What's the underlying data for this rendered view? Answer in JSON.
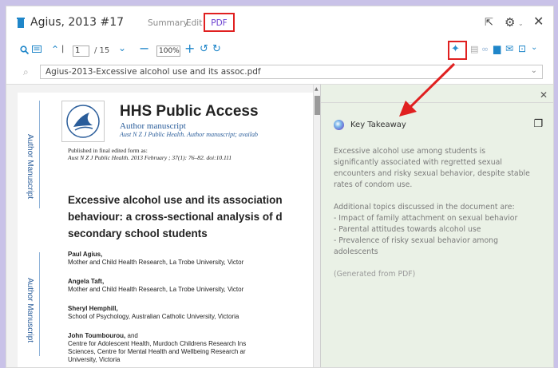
{
  "window": {
    "title": "Agius, 2013 #17",
    "tabs": [
      "Summary",
      "Edit",
      "PDF"
    ],
    "icons_right": [
      "external-link-icon",
      "gear-icon",
      "close-icon"
    ]
  },
  "toolbar": {
    "page_current": "1",
    "page_total": "/ 15",
    "zoom": "100%"
  },
  "file": {
    "name": "Agius-2013-Excessive alcohol use and its assoc.pdf"
  },
  "pdf": {
    "header": "HHS Public Access",
    "author_manuscript": "Author manuscript",
    "journal_line": "Aust N Z J Public Health. Author manuscript; availab",
    "published_in": "Published in final edited form as:",
    "citation": "Aust N Z J Public Health. 2013 February ; 37(1): 76–82. doi:10.111",
    "side_label": "Author Manuscript",
    "title_lines": [
      "Excessive alcohol use and its association",
      "behaviour: a cross-sectional analysis of d",
      "secondary school students"
    ],
    "authors": [
      {
        "name": "Paul Agius,",
        "affil": "Mother and Child Health Research, La Trobe University, Victor"
      },
      {
        "name": "Angela Taft,",
        "affil": "Mother and Child Health Research, La Trobe University, Victor"
      },
      {
        "name": "Sheryl Hemphill,",
        "affil": "School of Psychology, Australian Catholic University, Victoria"
      },
      {
        "name": "John Toumbourou,",
        "suffix": "and",
        "affil": "Centre for Adolescent Health, Murdoch Childrens Research Ins"
      }
    ],
    "extra_lines": [
      "Sciences, Centre for Mental Health and Wellbeing Research ar",
      "University, Victoria"
    ]
  },
  "ai_panel": {
    "heading": "Key Takeaway",
    "paragraph1": [
      "Excessive alcohol use among students is",
      "significantly associated with regretted sexual",
      "encounters and risky sexual behavior, despite stable",
      "rates of condom use."
    ],
    "paragraph2": [
      "Additional topics discussed in the document are:",
      "- Impact of family attachment on sexual behavior",
      "- Parental attitudes towards alcohol use",
      "- Prevalence of risky sexual behavior among",
      "adolescents"
    ],
    "generated": "(Generated from PDF)"
  },
  "colors": {
    "accent": "#1f86c9",
    "highlight_red": "#e02020",
    "panel_bg": "#eaf1e6",
    "outer_bg": "#c9c2e8",
    "pdf_tab": "#6a3fd0"
  }
}
